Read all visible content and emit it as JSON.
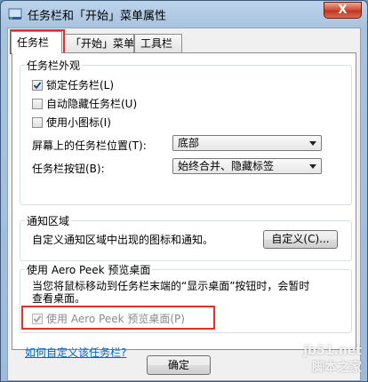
{
  "window": {
    "title": "任务栏和「开始」菜单属性",
    "close_label": "X"
  },
  "tabs": [
    {
      "label": "任务栏",
      "active": true
    },
    {
      "label": "「开始」菜单",
      "active": false
    },
    {
      "label": "工具栏",
      "active": false
    }
  ],
  "appearance": {
    "title": "任务栏外观",
    "lock_taskbar": {
      "label": "锁定任务栏(L)",
      "checked": true
    },
    "auto_hide": {
      "label": "自动隐藏任务栏(U)",
      "checked": false
    },
    "small_icons": {
      "label": "使用小图标(I)",
      "checked": false
    },
    "location_label": "屏幕上的任务栏位置(T):",
    "location_value": "底部",
    "buttons_label": "任务栏按钮(B):",
    "buttons_value": "始终合并、隐藏标签"
  },
  "notification": {
    "title": "通知区域",
    "description": "自定义通知区域中出现的图标和通知。",
    "customize_button": "自定义(C)..."
  },
  "aero_peek": {
    "title": "使用 Aero Peek 预览桌面",
    "description_line1": "当您将鼠标移动到任务栏末端的“显示桌面”按钮时，会暂时",
    "description_line2": "查看桌面。",
    "checkbox_label": "使用 Aero Peek 预览桌面(P)",
    "checked": true,
    "disabled": true
  },
  "help_link": "如何自定义该任务栏?",
  "ok_button": "确定",
  "watermark": {
    "site": "jb51.net",
    "brand": "脚本之家"
  }
}
